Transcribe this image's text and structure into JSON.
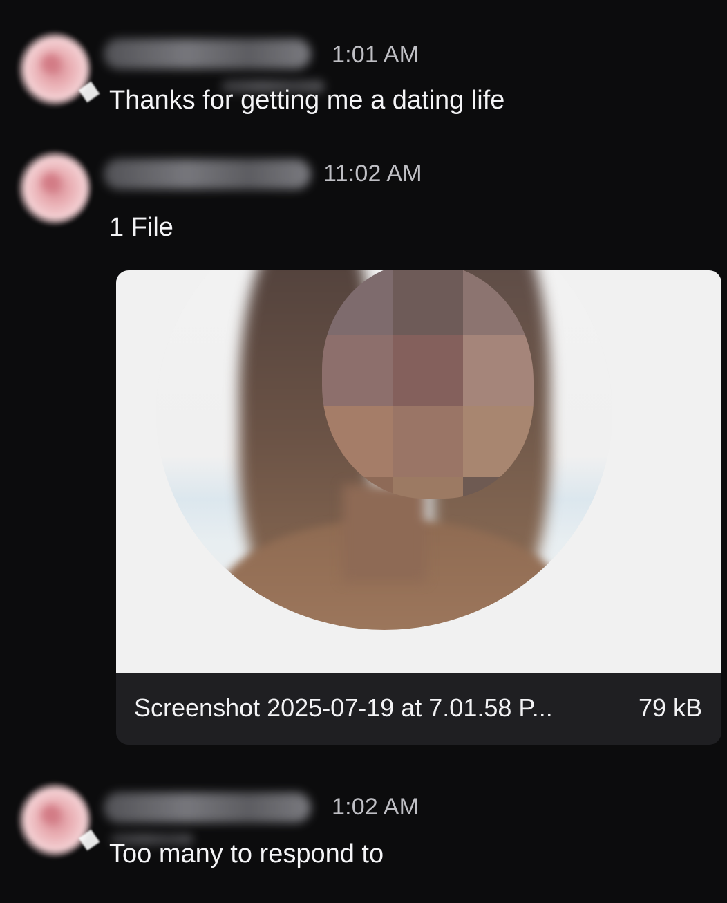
{
  "messages": [
    {
      "time": "1:01 AM",
      "text": "Thanks for getting me a dating life"
    },
    {
      "time": "11:02 AM",
      "text": "1 File",
      "attachment": {
        "file_name": "Screenshot 2025-07-19 at 7.01.58 P...",
        "file_size": "79 kB"
      }
    },
    {
      "time": "1:02 AM",
      "text": "Too many to respond to"
    }
  ],
  "colors": {
    "background": "#0c0c0d",
    "file_bar": "#1f1f22",
    "timestamp": "#bfbfc4",
    "avatar": "#e9aeb3"
  }
}
